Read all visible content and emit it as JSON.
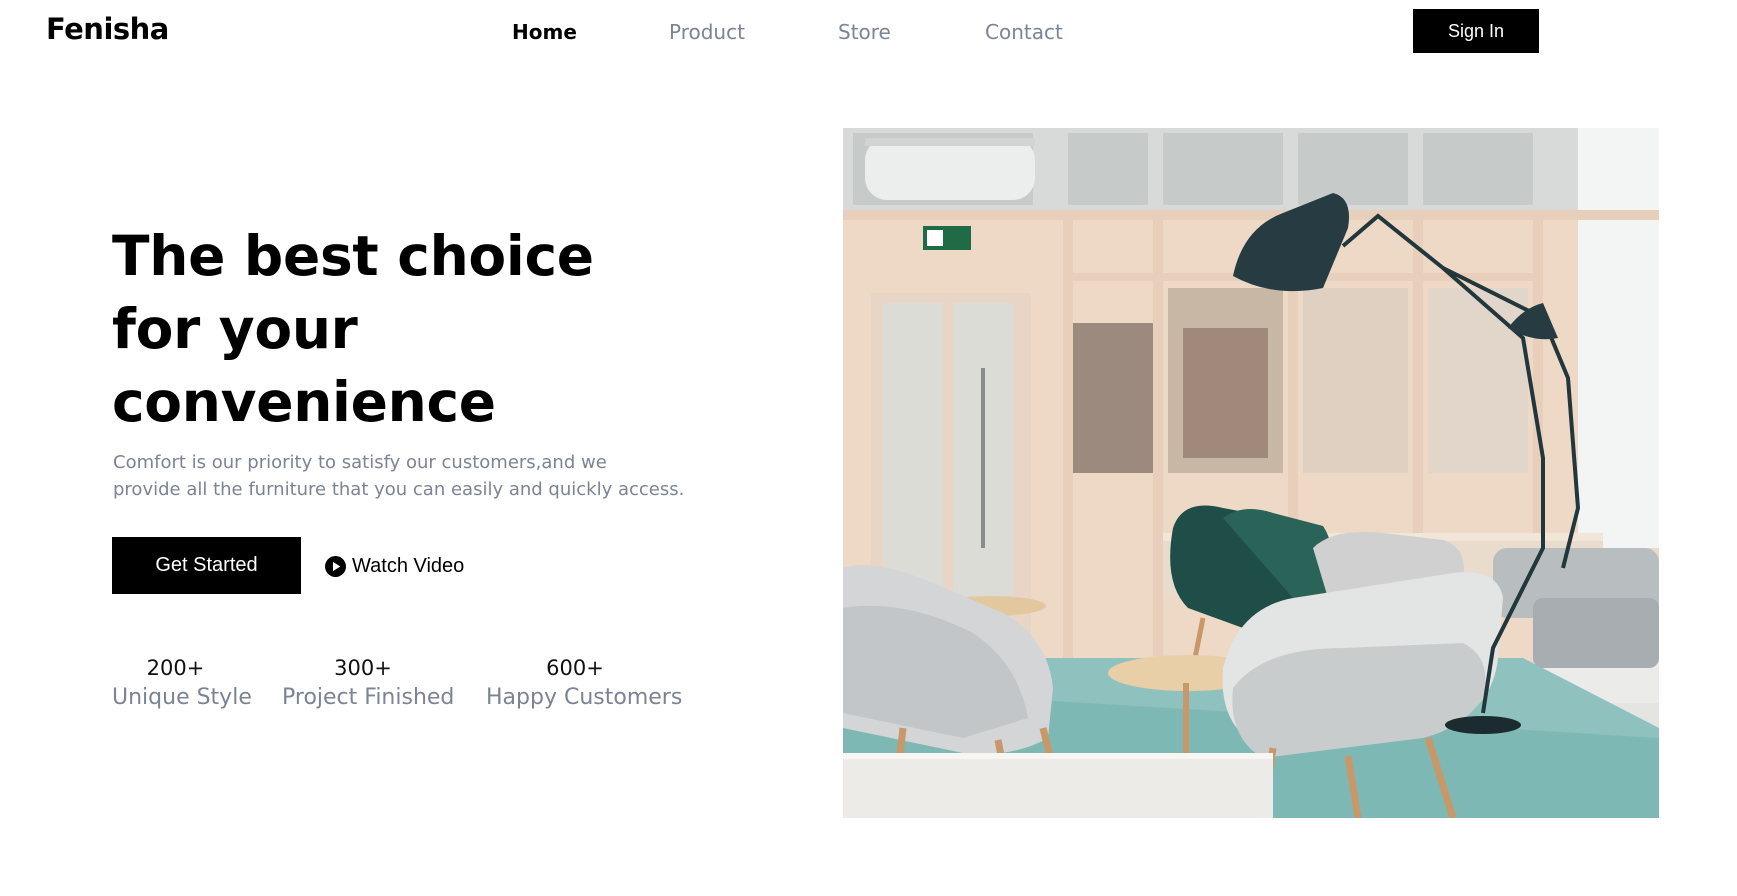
{
  "header": {
    "brand": "Fenisha",
    "nav": [
      {
        "label": "Home",
        "active": true
      },
      {
        "label": "Product",
        "active": false
      },
      {
        "label": "Store",
        "active": false
      },
      {
        "label": "Contact",
        "active": false
      }
    ],
    "sign_in_label": "Sign In"
  },
  "hero": {
    "headline_lines": [
      "The best choice",
      "for your",
      "convenience"
    ],
    "subtext_lines": [
      "Comfort is our priority to satisfy our customers,and we",
      "provide all the furniture that you can easily and quickly access."
    ],
    "primary_button_label": "Get Started",
    "video_link_label": "Watch Video",
    "video_icon": "play-circle-icon",
    "stats": [
      {
        "value": "200+",
        "label": "Unique Style"
      },
      {
        "value": "300+",
        "label": "Project Finished"
      },
      {
        "value": "600+",
        "label": "Happy Customers"
      }
    ]
  },
  "colors": {
    "accent": "#000000",
    "muted_text": "#7b8494",
    "background": "#ffffff"
  }
}
